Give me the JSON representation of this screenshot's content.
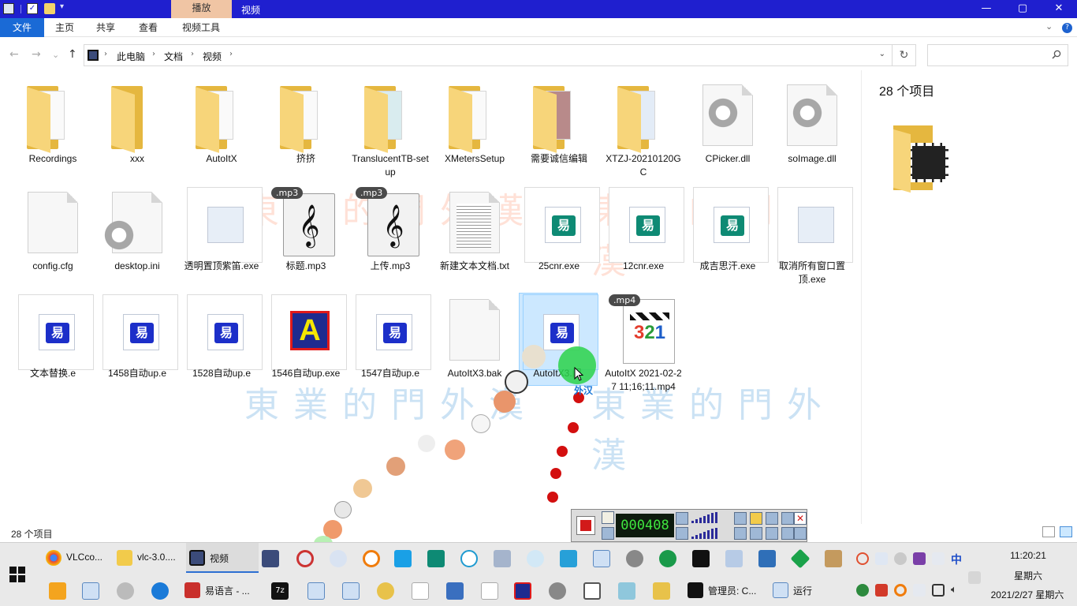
{
  "window": {
    "title": "视频",
    "context_tab": "播放",
    "controls": {
      "minimize": "—",
      "maximize": "▢",
      "close": "✕"
    }
  },
  "ribbon": {
    "tabs": [
      {
        "label": "文件"
      },
      {
        "label": "主页"
      },
      {
        "label": "共享"
      },
      {
        "label": "查看"
      },
      {
        "label": "视频工具"
      }
    ],
    "expand_icon": "chevron-down-icon",
    "help": "?"
  },
  "nav": {
    "back": "←",
    "forward": "→",
    "recent": "⌄",
    "up": "↑",
    "breadcrumb": [
      "此电脑",
      "文档",
      "视频"
    ],
    "refresh": "↻",
    "search_placeholder": ""
  },
  "items": [
    {
      "name": "Recordings",
      "type": "folder"
    },
    {
      "name": "xxx",
      "type": "folder"
    },
    {
      "name": "AutoItX",
      "type": "folder"
    },
    {
      "name": "挤挤",
      "type": "folder"
    },
    {
      "name": "TranslucentTB-setup",
      "type": "folder"
    },
    {
      "name": "XMetersSetup",
      "type": "folder"
    },
    {
      "name": "需要诚信编辑",
      "type": "folder"
    },
    {
      "name": "XTZJ-20210120GC",
      "type": "folder"
    },
    {
      "name": "CPicker.dll",
      "type": "dll"
    },
    {
      "name": "soImage.dll",
      "type": "dll"
    },
    {
      "name": "config.cfg",
      "type": "file"
    },
    {
      "name": "desktop.ini",
      "type": "ini"
    },
    {
      "name": "透明置顶紫笛.exe",
      "type": "exe"
    },
    {
      "name": "标题.mp3",
      "type": "mp3",
      "badge": ".mp3"
    },
    {
      "name": "上传.mp3",
      "type": "mp3",
      "badge": ".mp3"
    },
    {
      "name": "新建文本文档.txt",
      "type": "txt"
    },
    {
      "name": "25cnr.exe",
      "type": "exe-e"
    },
    {
      "name": "12cnr.exe",
      "type": "exe-e"
    },
    {
      "name": "成吉思汗.exe",
      "type": "exe-e"
    },
    {
      "name": "取消所有窗口置顶.exe",
      "type": "exe"
    },
    {
      "name": "文本替换.e",
      "type": "e"
    },
    {
      "name": "1458自动up.e",
      "type": "e"
    },
    {
      "name": "1528自动up.e",
      "type": "e"
    },
    {
      "name": "1546自动up.exe",
      "type": "app-a"
    },
    {
      "name": "1547自动up.e",
      "type": "e"
    },
    {
      "name": "AutoItX3.bak",
      "type": "file"
    },
    {
      "name": "AutoItX3.门",
      "type": "e",
      "selected": true
    },
    {
      "name": "AutoItX 2021-02-27 11;16;11.mp4",
      "type": "mp4",
      "badge": ".mp4"
    }
  ],
  "watermark_text": "東業的門外漢",
  "cursor_label": "外汉",
  "details": {
    "count": "28 个项目"
  },
  "status": {
    "count": "28 个项目"
  },
  "recorder": {
    "time": "000408"
  },
  "taskbar": {
    "row1": [
      {
        "label": "VLCco...",
        "icon": "chrome-icon"
      },
      {
        "label": "vlc-3.0....",
        "icon": "folder-icon"
      },
      {
        "label": "视频",
        "icon": "film-folder-icon",
        "active": true
      }
    ],
    "row2": [
      {
        "label": "易语言 - ...",
        "icon": "e-language-icon"
      },
      {
        "label": "管理员: C...",
        "icon": "cmd-icon"
      },
      {
        "label": "运行",
        "icon": "run-icon"
      }
    ],
    "ime": "中",
    "time": "11:20:21",
    "weekday": "星期六",
    "date": "2021/2/27 星期六"
  },
  "colors": {
    "titlebar": "#1f1fcf",
    "file_tab": "#1a6ad6",
    "context_tab": "#f0c5a4",
    "selection": "#cce8ff",
    "folder": "#f7d57a"
  }
}
